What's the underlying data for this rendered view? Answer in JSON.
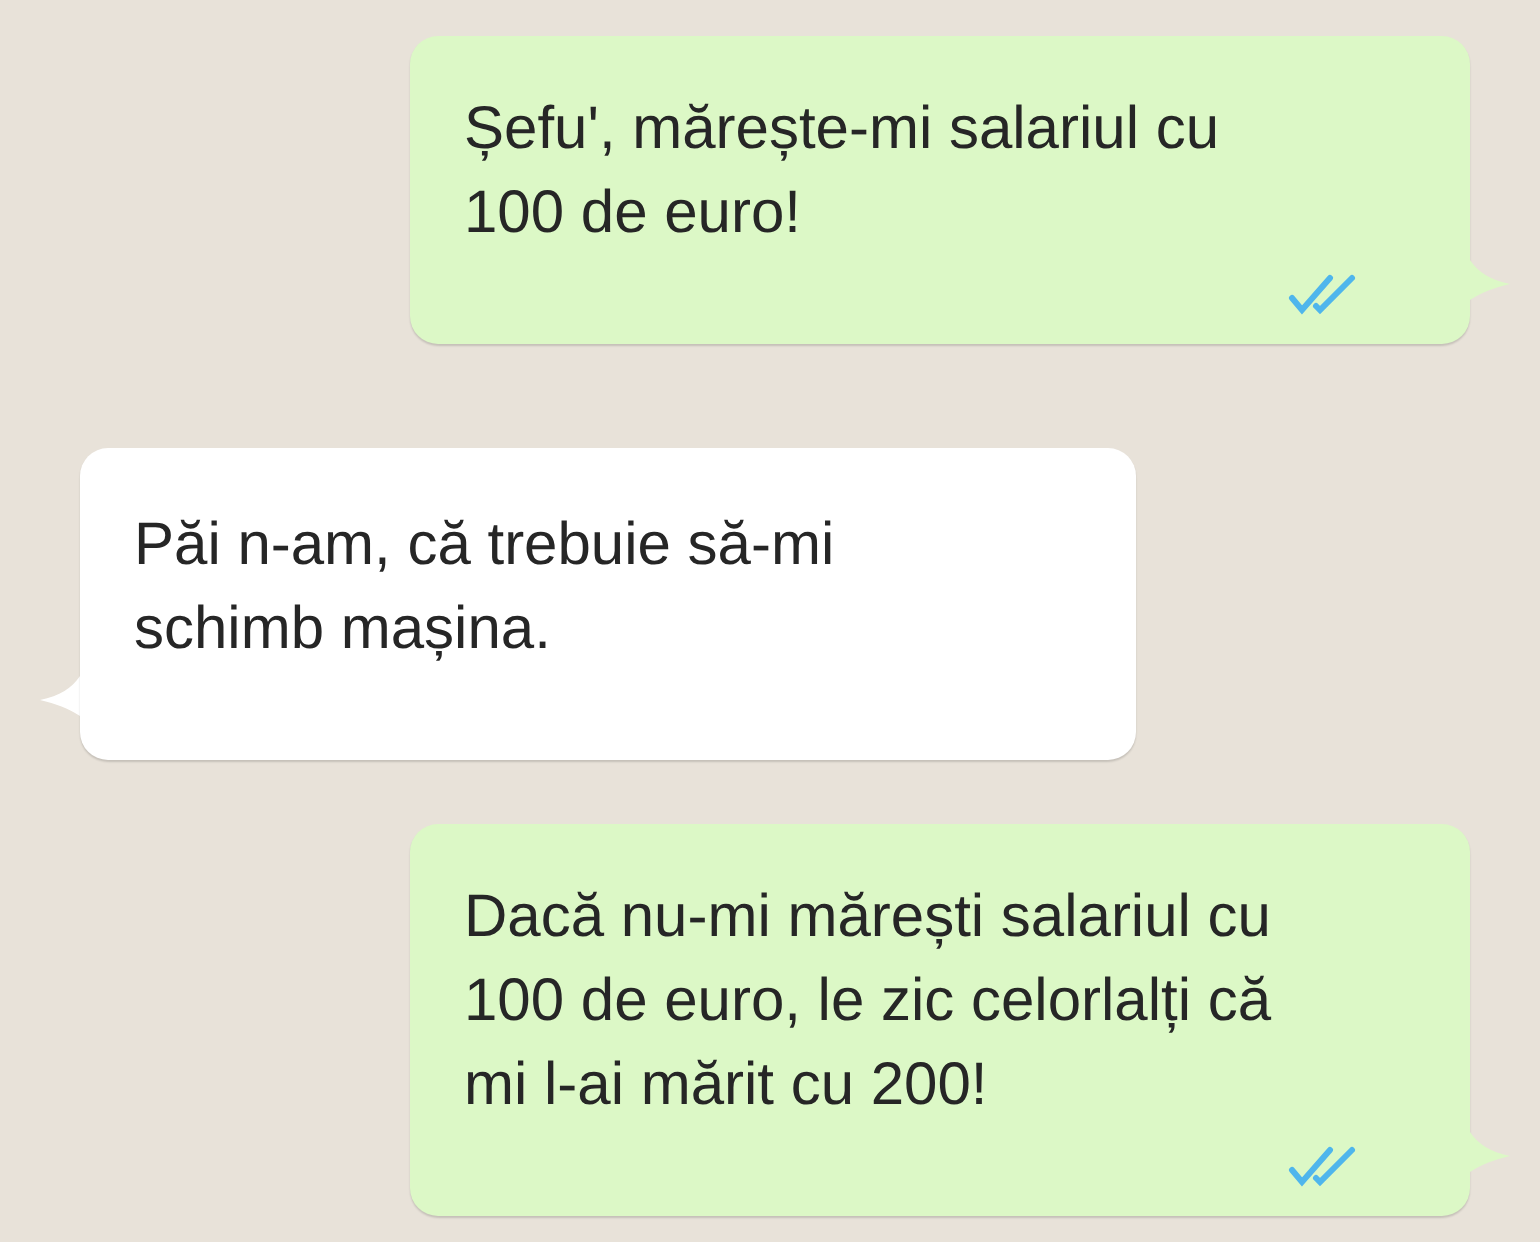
{
  "messages": [
    {
      "kind": "outgoing",
      "text": "Șefu', mărește-mi salariul cu\n100 de euro!",
      "read": true
    },
    {
      "kind": "incoming",
      "text": "Păi n-am, că trebuie să-mi\nschimb mașina."
    },
    {
      "kind": "outgoing",
      "text": "Dacă nu-mi mărești salariul cu\n100 de euro, le zic celorlalți că\nmi l-ai mărit cu 200!",
      "read": true
    }
  ]
}
